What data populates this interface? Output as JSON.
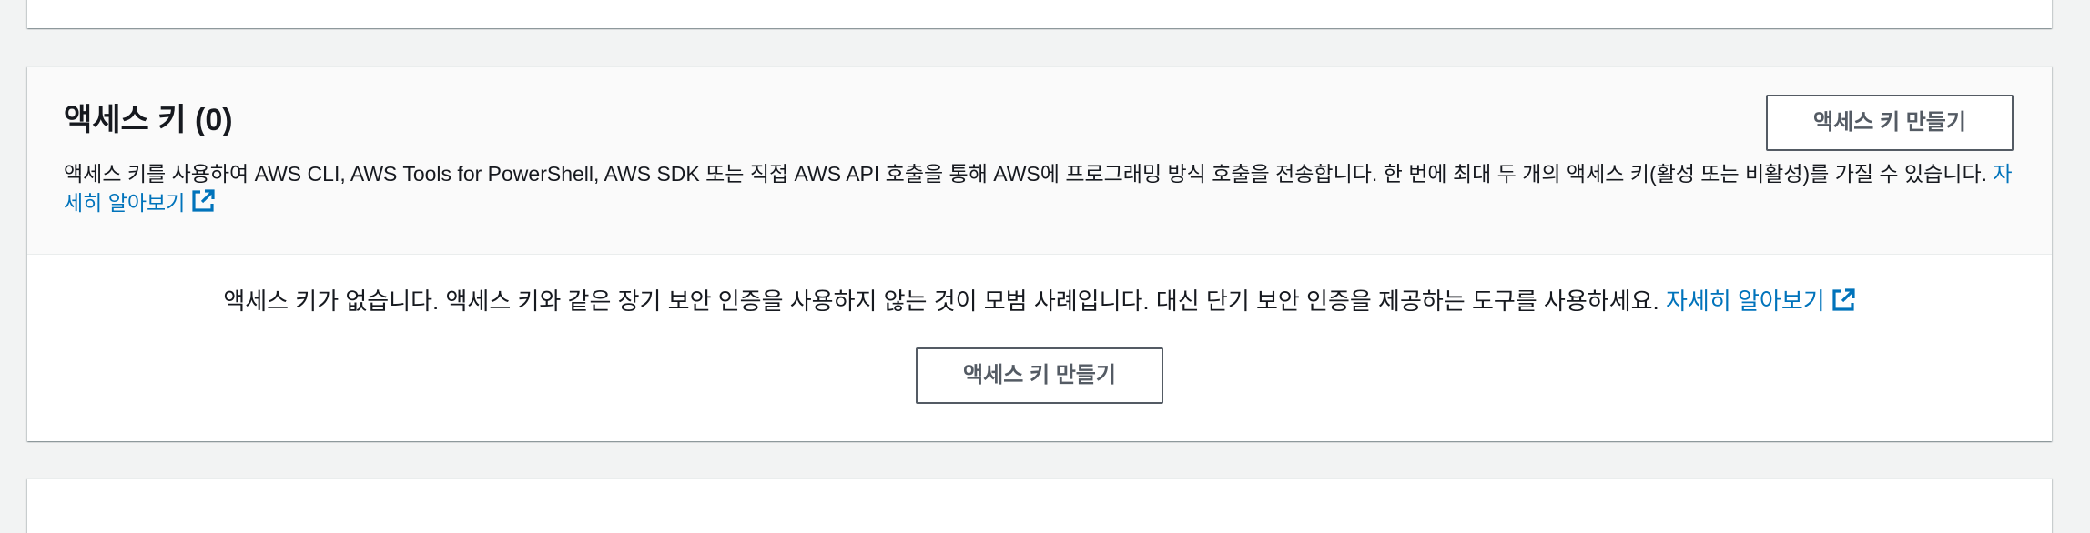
{
  "access_keys": {
    "title": "액세스 키 (0)",
    "create_button_label": "액세스 키 만들기",
    "description": "액세스 키를 사용하여 AWS CLI, AWS Tools for PowerShell, AWS SDK 또는 직접 AWS API 호출을 통해 AWS에 프로그래밍 방식 호출을 전송합니다. 한 번에 최대 두 개의 액세스 키(활성 또는 비활성)를 가질 수 있습니다.",
    "description_link": "자세히 알아보기",
    "empty_state": {
      "message": "액세스 키가 없습니다. 액세스 키와 같은 장기 보안 인증을 사용하지 않는 것이 모범 사례입니다. 대신 단기 보안 인증을 제공하는 도구를 사용하세요.",
      "link": "자세히 알아보기",
      "create_button_label": "액세스 키 만들기"
    },
    "icons": {
      "external_link": "external-link-icon"
    },
    "colors": {
      "link": "#0073bb",
      "button_border": "#545b64",
      "header_background": "#fafafa",
      "page_background": "#f2f3f3"
    }
  }
}
